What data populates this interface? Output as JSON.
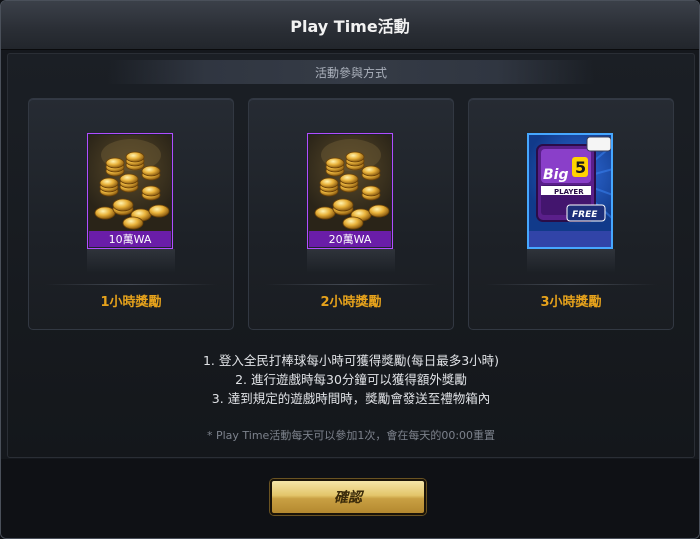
{
  "window": {
    "title": "Play Time活動"
  },
  "section": {
    "subtitle": "活動參與方式"
  },
  "rewards": [
    {
      "item_label": "10萬WA",
      "reward_label": "1小時獎勵",
      "icon": "gold-coins-icon"
    },
    {
      "item_label": "20萬WA",
      "reward_label": "2小時獎勵",
      "icon": "gold-coins-icon"
    },
    {
      "item_label": "",
      "reward_label": "3小時獎勵",
      "icon": "big5-player-card-icon",
      "card_text": {
        "big": "Big",
        "num": "5",
        "player": "PLAYER",
        "free": "FREE"
      }
    }
  ],
  "instructions": [
    "1. 登入全民打棒球每小時可獲得獎勵(每日最多3小時)",
    "2. 進行遊戲時每30分鐘可以獲得額外獎勵",
    "3. 達到規定的遊戲時間時，獎勵會發送至禮物箱內"
  ],
  "note": "* Play Time活動每天可以參加1次，會在每天的00:00重置",
  "footer": {
    "confirm_label": "確認"
  },
  "colors": {
    "accent_gold": "#e6a21c",
    "item_border_purple": "#b14dff",
    "item_border_blue": "#46a7ff"
  }
}
